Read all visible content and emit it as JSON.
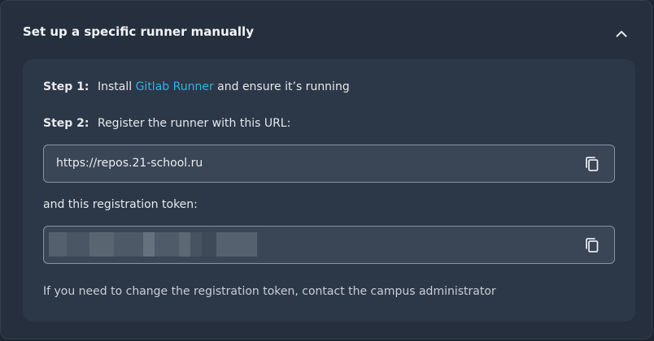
{
  "section": {
    "title": "Set up a specific runner manually",
    "toggle_icon": "chevron-up-icon"
  },
  "step1": {
    "label": "Step 1:",
    "prefix": "Install",
    "link": "Gitlab Runner",
    "suffix": "and ensure it’s running"
  },
  "step2": {
    "label": "Step 2:",
    "text": "Register the runner with this URL:"
  },
  "url_field": {
    "value": "https://repos.21-school.ru",
    "copy_icon": "copy-icon"
  },
  "token_label": "and this registration token:",
  "token_field": {
    "masked": true,
    "copy_icon": "copy-icon"
  },
  "footer_note": "If you need to change the registration token, contact the campus administrator",
  "colors": {
    "background": "#252f3d",
    "card": "#2c3747",
    "link": "#29b6e6",
    "field": "#3a4555"
  }
}
